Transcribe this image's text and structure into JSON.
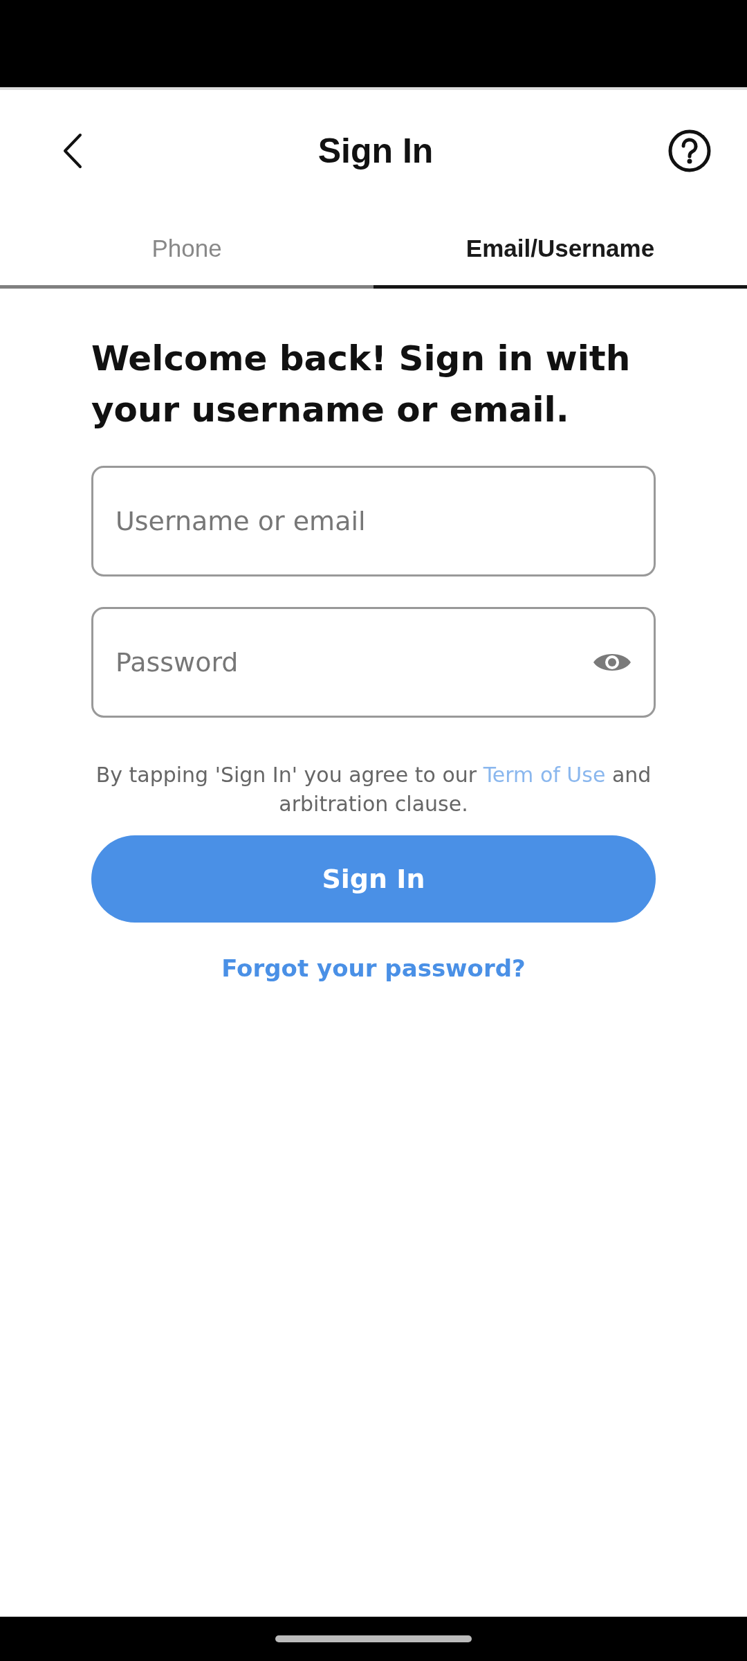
{
  "header": {
    "title": "Sign In"
  },
  "tabs": [
    {
      "label": "Phone",
      "selected": false
    },
    {
      "label": "Email/Username",
      "selected": true
    }
  ],
  "heading": "Welcome back! Sign in with your username or email.",
  "fields": [
    {
      "kind": "text",
      "placeholder": "Username or email"
    },
    {
      "kind": "password",
      "placeholder": "Password"
    }
  ],
  "terms": {
    "before": "By tapping 'Sign In' you agree to our",
    "link": "Term of Use",
    "after": "and arbitration clause."
  },
  "sign_in_button": "Sign In",
  "forgot_link": "Forgot your password?"
}
